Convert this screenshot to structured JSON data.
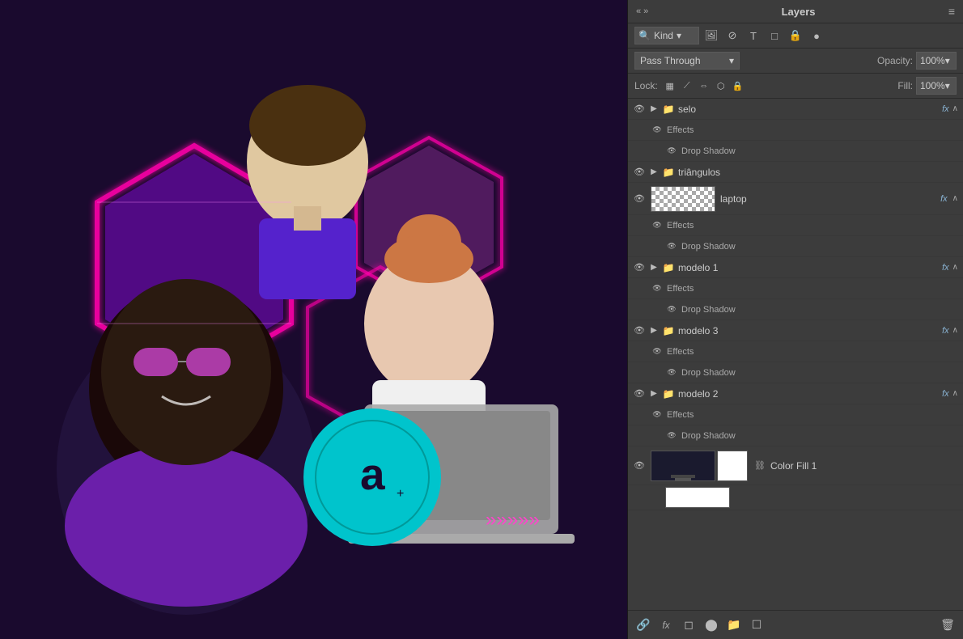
{
  "panel": {
    "title": "Layers",
    "menu_icon": "≡",
    "collapse_arrows": "« »",
    "close_x": "×"
  },
  "toolbar": {
    "kind_label": "Kind",
    "filter_icons": [
      "🖼",
      "⊘",
      "T",
      "□",
      "🔒",
      "●"
    ],
    "blend_mode": "Pass Through",
    "blend_arrow": "▾",
    "opacity_label": "Opacity:",
    "opacity_value": "100%",
    "opacity_arrow": "▾",
    "lock_label": "Lock:",
    "lock_icons": [
      "▦",
      "⟋",
      "⇔",
      "⬡",
      "🔒"
    ],
    "fill_label": "Fill:",
    "fill_value": "100%",
    "fill_arrow": "▾"
  },
  "layers": [
    {
      "id": "selo",
      "type": "folder",
      "visible": true,
      "expanded": true,
      "name": "selo",
      "has_fx": true,
      "children": [
        {
          "id": "selo-effects",
          "type": "effects",
          "label": "Effects"
        },
        {
          "id": "selo-drop-shadow",
          "type": "drop-shadow",
          "label": "Drop Shadow"
        }
      ]
    },
    {
      "id": "triangulos",
      "type": "folder",
      "visible": true,
      "expanded": false,
      "name": "triângulos",
      "has_fx": false,
      "children": []
    },
    {
      "id": "laptop",
      "type": "layer",
      "visible": true,
      "name": "laptop",
      "has_fx": true,
      "thumb_type": "checker",
      "children": [
        {
          "id": "laptop-effects",
          "type": "effects",
          "label": "Effects"
        },
        {
          "id": "laptop-drop-shadow",
          "type": "drop-shadow",
          "label": "Drop Shadow"
        }
      ]
    },
    {
      "id": "modelo1",
      "type": "folder",
      "visible": true,
      "expanded": false,
      "name": "modelo 1",
      "has_fx": true,
      "children": [
        {
          "id": "modelo1-effects",
          "type": "effects",
          "label": "Effects"
        },
        {
          "id": "modelo1-drop-shadow",
          "type": "drop-shadow",
          "label": "Drop Shadow"
        }
      ]
    },
    {
      "id": "modelo3",
      "type": "folder",
      "visible": true,
      "expanded": false,
      "name": "modelo 3",
      "has_fx": true,
      "children": [
        {
          "id": "modelo3-effects",
          "type": "effects",
          "label": "Effects"
        },
        {
          "id": "modelo3-drop-shadow",
          "type": "drop-shadow",
          "label": "Drop Shadow"
        }
      ]
    },
    {
      "id": "modelo2",
      "type": "folder",
      "visible": true,
      "expanded": false,
      "name": "modelo 2",
      "has_fx": true,
      "children": [
        {
          "id": "modelo2-effects",
          "type": "effects",
          "label": "Effects"
        },
        {
          "id": "modelo2-drop-shadow",
          "type": "drop-shadow",
          "label": "Drop Shadow"
        }
      ]
    },
    {
      "id": "colorfill1",
      "type": "fill-layer",
      "visible": true,
      "name": "Color Fill 1",
      "has_fx": false,
      "thumb_dark": true,
      "thumb_light": true
    }
  ],
  "bottom_tools": {
    "link_icon": "🔗",
    "fx_icon": "fx",
    "adjust_icon": "⬤",
    "mask_icon": "◻",
    "folder_icon": "📁",
    "new_layer_icon": "☐",
    "trash_icon": "🗑"
  }
}
